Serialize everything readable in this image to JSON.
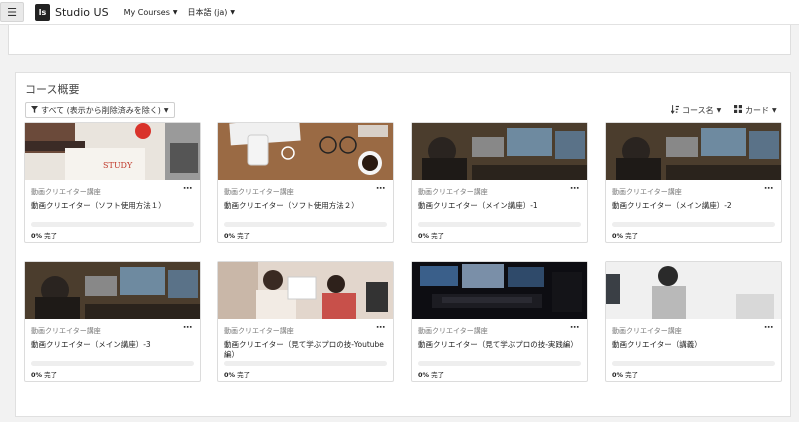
{
  "navbar": {
    "menu_icon": "hamburger-icon",
    "logo_text": "ls",
    "site_name": "Studio US",
    "my_courses": "My Courses",
    "language": "日本語 (ja)"
  },
  "overview": {
    "title": "コース概要",
    "filter_label": "すべて (表示から削除済みを除く)",
    "sort_label": "コース名",
    "view_label": "カード"
  },
  "courses": [
    {
      "category": "動画クリエイター講座",
      "title": "動画クリエイター（ソフト使用方法１）",
      "progress": 0,
      "progress_percent": "0%",
      "progress_suffix": "完了",
      "image": "study-desk"
    },
    {
      "category": "動画クリエイター講座",
      "title": "動画クリエイター（ソフト使用方法２）",
      "progress": 0,
      "progress_percent": "0%",
      "progress_suffix": "完了",
      "image": "desk-laptop-coffee"
    },
    {
      "category": "動画クリエイター講座",
      "title": "動画クリエイター（メイン講座）-1",
      "progress": 0,
      "progress_percent": "0%",
      "progress_suffix": "完了",
      "image": "editor-monitors"
    },
    {
      "category": "動画クリエイター講座",
      "title": "動画クリエイター（メイン講座）-2",
      "progress": 0,
      "progress_percent": "0%",
      "progress_suffix": "完了",
      "image": "editor-monitors"
    },
    {
      "category": "動画クリエイター講座",
      "title": "動画クリエイター（メイン講座）-3",
      "progress": 0,
      "progress_percent": "0%",
      "progress_suffix": "完了",
      "image": "editor-monitors"
    },
    {
      "category": "動画クリエイター講座",
      "title": "動画クリエイター（見て学ぶプロの技-Youtube編）",
      "progress": 0,
      "progress_percent": "0%",
      "progress_suffix": "完了",
      "image": "video-shoot"
    },
    {
      "category": "動画クリエイター講座",
      "title": "動画クリエイター（見て学ぶプロの技-実践編）",
      "progress": 0,
      "progress_percent": "0%",
      "progress_suffix": "完了",
      "image": "dark-studio"
    },
    {
      "category": "動画クリエイター講座",
      "title": "動画クリエイター（講義）",
      "progress": 0,
      "progress_percent": "0%",
      "progress_suffix": "完了",
      "image": "headset-lecturer"
    }
  ],
  "colors": {
    "accent": "#3a75c4",
    "navbar_bg": "#ffffff",
    "page_bg": "#f2f2f2"
  }
}
